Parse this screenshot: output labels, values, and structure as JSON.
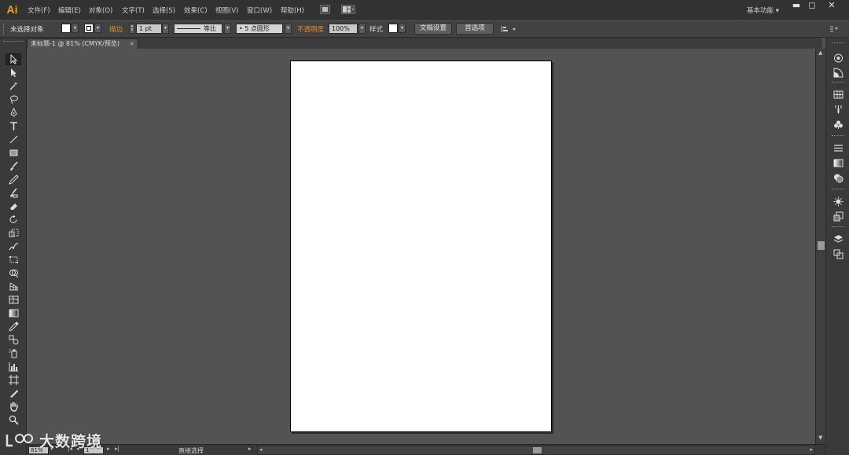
{
  "app": {
    "logo_text": "Ai"
  },
  "menubar": {
    "items": [
      "文件(F)",
      "编辑(E)",
      "对象(O)",
      "文字(T)",
      "选择(S)",
      "效果(C)",
      "视图(V)",
      "窗口(W)",
      "帮助(H)"
    ],
    "workspace": "基本功能",
    "workspace_arrow": "▾",
    "window_buttons": {
      "minimize": "▬",
      "maximize": "◻",
      "close": "✕"
    }
  },
  "controlbar": {
    "selection_label": "未选择对象",
    "stroke_label": "描边",
    "stroke_weight": "1 pt",
    "stroke_profile": "等比",
    "brush_label": "5 点圆形",
    "opacity_label": "不透明度",
    "opacity_value": "100%",
    "style_label": "样式",
    "doc_setup_button": "文档设置",
    "preferences_button": "首选项",
    "colors": {
      "fill": "#ffffff",
      "stroke_label": "#e8892a"
    }
  },
  "document": {
    "tab_title": "未标题-1 @ 81% (CMYK/预览)",
    "close_glyph": "×"
  },
  "statusbar": {
    "zoom": "81%",
    "page": "1",
    "status_text": "直接选择"
  },
  "watermark": {
    "text": "大数跨境"
  }
}
